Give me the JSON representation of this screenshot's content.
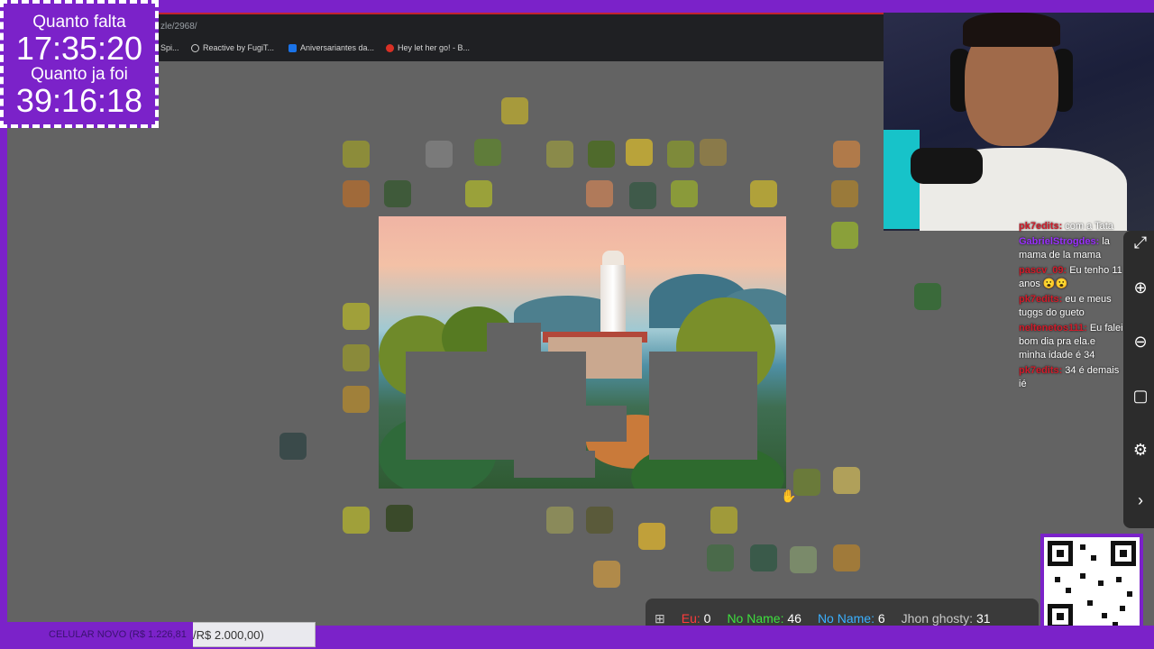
{
  "timer": {
    "remaining_label": "Quanto falta",
    "remaining_value": "17:35:20",
    "elapsed_label": "Quanto ja foi",
    "elapsed_value": "39:16:18"
  },
  "browser": {
    "url_fragment": "zle/2968/",
    "bookmarks": [
      {
        "label": "Spi...",
        "icon": "bookmark-icon",
        "color": "#4a90d9"
      },
      {
        "label": "Reactive by FugiT...",
        "icon": "globe-icon",
        "color": "#cfcfcf"
      },
      {
        "label": "Aniversariantes da...",
        "icon": "trello-icon",
        "color": "#1a73e8"
      },
      {
        "label": "Hey let her go! - B...",
        "icon": "red-circle-icon",
        "color": "#d93025"
      }
    ]
  },
  "chat": {
    "messages": [
      {
        "user": "pk7edits:",
        "text": "com a Tata"
      },
      {
        "user": "GabrielStrogdes:",
        "text": "la mama de la mama",
        "user_color": "#9b30ff"
      },
      {
        "user": "pascv_09:",
        "text": "Eu tenho 11 anos 😮😮"
      },
      {
        "user": "pk7edits:",
        "text": "eu e meus tuggs do gueto"
      },
      {
        "user": "neltenetos111:",
        "text": "Eu falei bom dia pra ela.e minha idade é 34"
      },
      {
        "user": "pk7edits:",
        "text": "34 é demais ié"
      }
    ]
  },
  "tools": [
    "expand-icon",
    "zoom-in-icon",
    "zoom-out-icon",
    "fit-icon",
    "settings-icon",
    "chevron-right-icon"
  ],
  "scoreboard": {
    "players": [
      {
        "label": "Eu:",
        "value": "0",
        "color": "#ff3b3b"
      },
      {
        "label": "No Name:",
        "value": "46",
        "color": "#3ee03e"
      },
      {
        "label": "No Name:",
        "value": "6",
        "color": "#3ab0ff"
      },
      {
        "label": "Jhon ghosty:",
        "value": "31",
        "color": "#c8c8c8"
      }
    ]
  },
  "goal": {
    "current_label": "CELULAR NOVO (R$ 1.226,81",
    "target_label": "/R$ 2.000,00)",
    "progress": 0.61
  },
  "colors": {
    "frame": "#7b22c9",
    "canvas": "#636363"
  }
}
